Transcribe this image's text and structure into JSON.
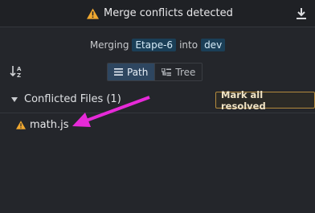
{
  "header": {
    "title": "Merge conflicts detected",
    "warning_icon": "warning-icon",
    "download_icon": "download-icon"
  },
  "merge_info": {
    "prefix": "Merging",
    "source_branch": "Etape-6",
    "connector": "into",
    "target_branch": "dev"
  },
  "view_toggle": {
    "sort_icon": "sort-az-icon",
    "options": [
      {
        "label": "Path",
        "icon": "list-icon",
        "active": true
      },
      {
        "label": "Tree",
        "icon": "tree-icon",
        "active": false
      }
    ]
  },
  "conflicts": {
    "section_label": "Conflicted Files (1)",
    "resolve_button": "Mark all resolved",
    "files": [
      {
        "name": "math.js",
        "icon": "warning-icon"
      }
    ]
  },
  "colors": {
    "background": "#24262b",
    "branch_badge": "#1b3f57",
    "warning": "#f0a830",
    "annotation_arrow": "#e62ad8"
  }
}
